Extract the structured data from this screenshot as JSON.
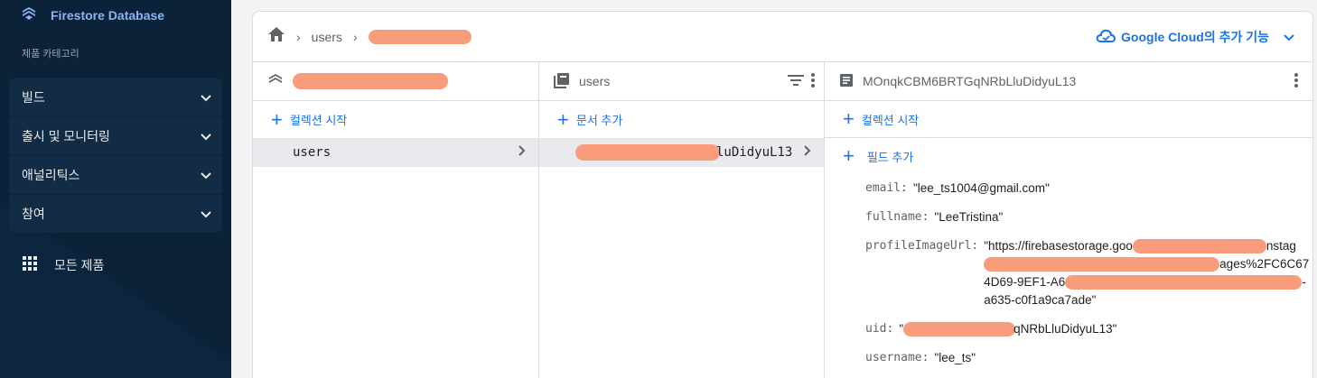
{
  "sidebar": {
    "title": "Firestore Database",
    "category": "제품 카테고리",
    "items": [
      {
        "label": "빌드"
      },
      {
        "label": "출시 및 모니터링"
      },
      {
        "label": "애널리틱스"
      },
      {
        "label": "참여"
      }
    ],
    "all_products": "모든 제품"
  },
  "breadcrumb": {
    "items": [
      "users"
    ]
  },
  "header": {
    "google_cloud": "Google Cloud의 추가 기능"
  },
  "col1": {
    "action": "컬렉션 시작",
    "selected": "users"
  },
  "col2": {
    "title": "users",
    "action": "문서 추가",
    "selected_suffix": "luDidyuL13"
  },
  "col3": {
    "title": "MOnqkCBM6BRTGqNRbLluDidyuL13",
    "action": "컬렉션 시작",
    "add_field": "필드 추가",
    "fields": {
      "email": {
        "key": "email:",
        "value": "\"lee_ts1004@gmail.com\""
      },
      "fullname": {
        "key": "fullname:",
        "value": "\"LeeTristina\""
      },
      "profileImageUrl": {
        "key": "profileImageUrl:",
        "line1": "\"https://firebasestorage.goo",
        "line1_end": "nstag",
        "line2_end": "ages%2FC6C67",
        "line3": "4D69-9EF1-A6",
        "line3_end": "-",
        "line4": "a635-c0f1a9ca7ade\""
      },
      "uid": {
        "key": "uid:",
        "value_prefix": "\"",
        "value_suffix": "qNRbLluDidyuL13\""
      },
      "username": {
        "key": "username:",
        "value": "\"lee_ts\""
      }
    }
  },
  "colors": {
    "sidebar_bg": "#0b2239",
    "accent": "#1a73e8",
    "redaction": "#f99c7b"
  }
}
